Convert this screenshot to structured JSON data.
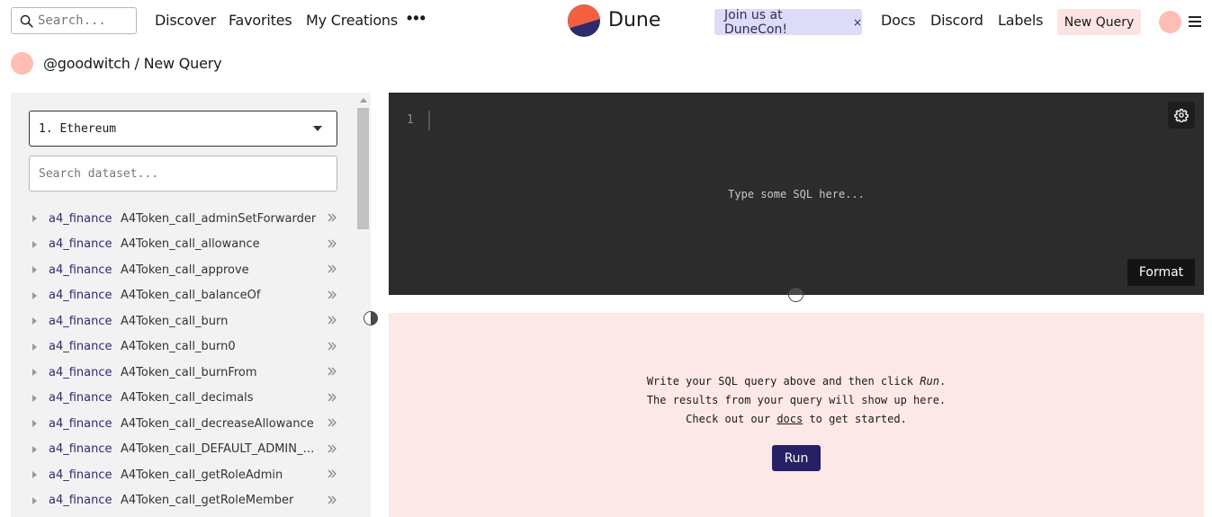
{
  "header": {
    "search_placeholder": "Search...",
    "nav": [
      "Discover",
      "Favorites",
      "My Creations"
    ],
    "more_label": "•••",
    "logo_text": "Dune",
    "promo_label": "Join us at DuneCon!",
    "promo_close": "×",
    "right_links": [
      "Docs",
      "Discord",
      "Labels"
    ],
    "new_query_label": "New Query"
  },
  "breadcrumb": {
    "text": "@goodwitch / New Query"
  },
  "sidebar": {
    "dataset_selected": "1. Ethereum",
    "search_placeholder": "Search dataset...",
    "rows": [
      {
        "schema": "a4_finance",
        "table": "A4Token_call_adminSetForwarder"
      },
      {
        "schema": "a4_finance",
        "table": "A4Token_call_allowance"
      },
      {
        "schema": "a4_finance",
        "table": "A4Token_call_approve"
      },
      {
        "schema": "a4_finance",
        "table": "A4Token_call_balanceOf"
      },
      {
        "schema": "a4_finance",
        "table": "A4Token_call_burn"
      },
      {
        "schema": "a4_finance",
        "table": "A4Token_call_burn0"
      },
      {
        "schema": "a4_finance",
        "table": "A4Token_call_burnFrom"
      },
      {
        "schema": "a4_finance",
        "table": "A4Token_call_decimals"
      },
      {
        "schema": "a4_finance",
        "table": "A4Token_call_decreaseAllowance"
      },
      {
        "schema": "a4_finance",
        "table": "A4Token_call_DEFAULT_ADMIN_R..."
      },
      {
        "schema": "a4_finance",
        "table": "A4Token_call_getRoleAdmin"
      },
      {
        "schema": "a4_finance",
        "table": "A4Token_call_getRoleMember"
      }
    ]
  },
  "editor": {
    "line_number": "1",
    "placeholder": "Type some SQL here...",
    "format_label": "Format"
  },
  "results": {
    "line1_prefix": "Write your SQL query above and then click ",
    "line1_run": "Run",
    "line1_suffix": ".",
    "line2": "The results from your query will show up here.",
    "line3_prefix": "Check out our ",
    "line3_link": "docs",
    "line3_suffix": " to get started.",
    "run_label": "Run"
  },
  "icons": {
    "search": "search-icon",
    "logo": "dune-logo-icon",
    "settings": "gear-icon",
    "menu": "hamburger-icon",
    "row_open": "double-chevron-right-icon"
  },
  "colors": {
    "brand_orange": "#f4603e",
    "brand_navy": "#2b2b6e",
    "run_button": "#262166",
    "editor_bg": "#2c2c2c",
    "results_bg": "#fde8e8",
    "promo_bg": "#dcdcf8",
    "avatar": "#ffbdb3"
  }
}
